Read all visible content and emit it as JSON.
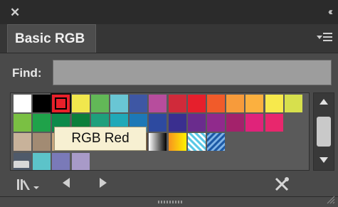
{
  "panel": {
    "close_glyph": "✕",
    "collapse_glyph": "‹‹",
    "tab_label": "Basic RGB",
    "menu_icon": "panel-menu-icon"
  },
  "find": {
    "label": "Find:",
    "value": "",
    "placeholder": ""
  },
  "tooltip": {
    "text": "RGB Red"
  },
  "swatches": {
    "selected": "RGB Red",
    "row1": [
      "#ffffff",
      "#000000",
      "#e8202a",
      "#f1e74d",
      "#62b857",
      "#69c6d4",
      "#3e57a4",
      "#b74d9d",
      "#d02a3a",
      "#e61f2c",
      "#f15b2a",
      "#f79b3b",
      "#fbb03f",
      "#f7e94c",
      "#d7e04d"
    ],
    "row2": [
      "#7ac043",
      "#1fa24a",
      "#0d8a4a",
      "#0c7f3b",
      "#1fa07c",
      "#20a9b8",
      "#1d78b7",
      "#2d4aa0",
      "#3a2f8f",
      "#6a2c8d",
      "#902a8c",
      "#a3226b",
      "#e0237a",
      "#e8276d"
    ],
    "row3": [
      "#c8b29a",
      "#a28b73",
      "#c7a57d",
      "#a77b54",
      "#8a5a32",
      "#6a3d1e",
      "#4e2c14",
      "gradient-gray",
      "gradient-orange",
      "pattern-dots",
      "pattern-blue"
    ],
    "row4": [
      "#4f5a6a",
      "#5cc3c9",
      "#7a7ab8",
      "#a89ac8"
    ]
  },
  "scrollbar": {
    "up_icon": "scroll-up-icon",
    "down_icon": "scroll-down-icon"
  },
  "bottom": {
    "library_icon": "swatch-libraries-menu-icon",
    "prev_icon": "previous-library-icon",
    "next_icon": "next-library-icon",
    "tools_icon": "swatch-tools-icon"
  }
}
